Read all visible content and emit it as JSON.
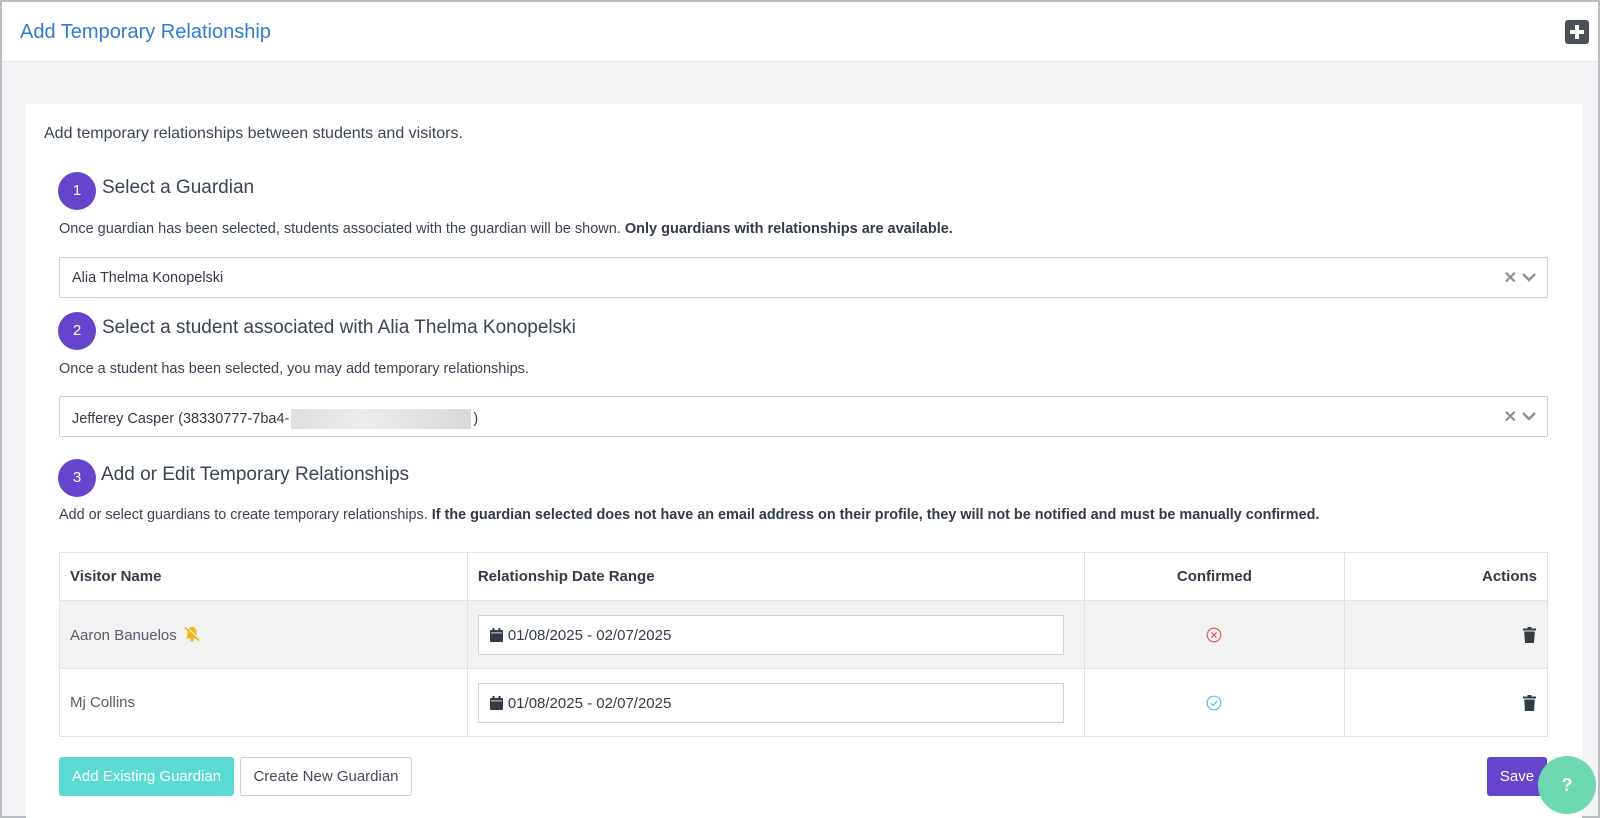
{
  "header": {
    "title": "Add Temporary Relationship",
    "expand_icon": "plus-square-icon"
  },
  "intro": "Add temporary relationships between students and visitors.",
  "steps": [
    {
      "number": "1",
      "title": "Select a Guardian",
      "description": "Once guardian has been selected, students associated with the guardian will be shown.",
      "description_bold": "Only guardians with relationships are available.",
      "select_value": "Alia Thelma Konopelski"
    },
    {
      "number": "2",
      "title": "Select a student associated with Alia Thelma Konopelski",
      "description": "Once a student has been selected, you may add temporary relationships.",
      "select_value_prefix": "Jefferey Casper (38330777-7ba4-",
      "select_value_suffix": ")"
    },
    {
      "number": "3",
      "title": "Add or Edit Temporary Relationships",
      "description": "Add or select guardians to create temporary relationships.",
      "description_bold": "If the guardian selected does not have an email address on their profile, they will not be notified and must be manually confirmed."
    }
  ],
  "table": {
    "headers": [
      "Visitor Name",
      "Relationship Date Range",
      "Confirmed",
      "Actions"
    ],
    "rows": [
      {
        "visitor_name": "Aaron Banuelos",
        "notify_icon": "bell-slash-icon",
        "date_range": "01/08/2025 - 02/07/2025",
        "confirmed_icon": "x-circle-icon",
        "action_icon": "trash-icon"
      },
      {
        "visitor_name": "Mj Collins",
        "date_range": "01/08/2025 - 02/07/2025",
        "confirmed_icon": "check-circle-icon",
        "action_icon": "trash-icon"
      }
    ]
  },
  "buttons": {
    "add_existing": "Add Existing Guardian",
    "create_new": "Create New Guardian",
    "save": "Save",
    "help": "?"
  },
  "colors": {
    "accent_purple": "#6545cc",
    "teal": "#5bd9d3",
    "link_blue": "#2f7bd6",
    "confirmed_no": "#e05a5a",
    "confirmed_yes": "#4cc7d8",
    "help_green": "#6dd8b0"
  }
}
